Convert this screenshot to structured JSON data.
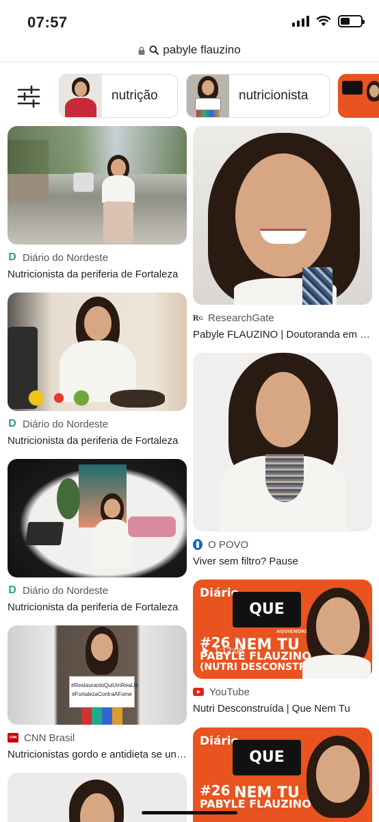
{
  "status": {
    "time": "07:57"
  },
  "url_bar": {
    "query": "pabyle flauzino"
  },
  "chips": [
    {
      "label": "nutrição"
    },
    {
      "label": "nutricionista"
    },
    {
      "label": ""
    }
  ],
  "left_column": [
    {
      "source": "Diário do Nordeste",
      "title": "Nutricionista da periferia de Fortaleza",
      "favicon": "diario-d-icon"
    },
    {
      "source": "Diário do Nordeste",
      "title": "Nutricionista da periferia de Fortaleza",
      "favicon": "diario-d-icon"
    },
    {
      "source": "Diário do Nordeste",
      "title": "Nutricionista da periferia de Fortaleza",
      "favicon": "diario-d-icon"
    },
    {
      "source": "CNN Brasil",
      "title": "Nutricionistas gordo e antidieta se unem",
      "favicon": "cnn-icon",
      "sign_text_1": "#RestaurantoQuiUmRealJá",
      "sign_text_2": "#FortalezaContraAFome"
    },
    {
      "source": "",
      "title": ""
    }
  ],
  "right_column": [
    {
      "source": "ResearchGate",
      "title": "Pabyle FLAUZINO | Doutoranda em Nutrição",
      "favicon": "researchgate-icon"
    },
    {
      "source": "O POVO",
      "title": "Viver sem filtro? Pause",
      "favicon": "opovo-icon"
    },
    {
      "source": "YouTube",
      "title": "Nutri Desconstruída | Que Nem Tu",
      "favicon": "youtube-icon",
      "video_time": "1:12:08",
      "brand": "Diário",
      "show_title": "QUE NEM TU",
      "episode": "#26",
      "guest": "PABYLE FLAUZINO",
      "guest_sub": "(NUTRI DESCONSTRUÍDA)",
      "tag": "AQUIENORDESTE"
    },
    {
      "source": "",
      "title": "",
      "brand": "Diário",
      "show_title": "QUE NEM TU",
      "episode": "#26",
      "guest": "PABYLE FLAUZINO"
    }
  ],
  "colors": {
    "accent_teal": "#2a9d8f",
    "youtube_red": "#e62117",
    "ad_orange": "#e8531f"
  }
}
